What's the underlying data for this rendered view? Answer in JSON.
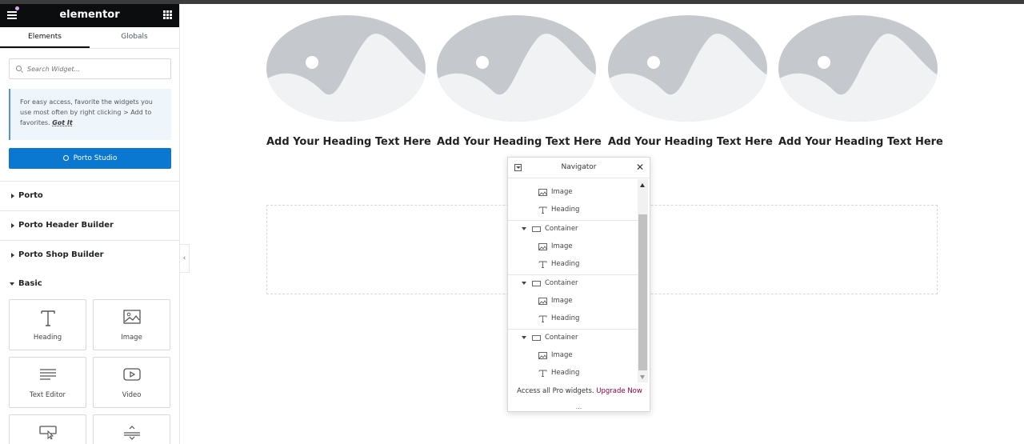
{
  "header": {
    "logo": "elementor"
  },
  "tabs": [
    {
      "label": "Elements"
    },
    {
      "label": "Globals"
    }
  ],
  "search": {
    "placeholder": "Search Widget..."
  },
  "tip": {
    "text": "For easy access, favorite the widgets you use most often by right clicking > Add to favorites.",
    "action": "Got It"
  },
  "porto_button": {
    "label": "Porto Studio"
  },
  "categories": [
    {
      "label": "Porto"
    },
    {
      "label": "Porto Header Builder"
    },
    {
      "label": "Porto Shop Builder"
    },
    {
      "label": "Basic"
    }
  ],
  "widgets": [
    {
      "label": "Heading"
    },
    {
      "label": "Image"
    },
    {
      "label": "Text Editor"
    },
    {
      "label": "Video"
    }
  ],
  "canvas": {
    "headings": [
      "Add Your Heading Text Here",
      "Add Your Heading Text Here",
      "Add Your Heading Text Here",
      "Add Your Heading Text Here"
    ]
  },
  "navigator": {
    "title": "Navigator",
    "rows": [
      {
        "label": "Image",
        "icon": "image-icon"
      },
      {
        "label": "Heading",
        "icon": "heading-icon"
      },
      {
        "label": "Container",
        "icon": "container-icon"
      },
      {
        "label": "Image",
        "icon": "image-icon"
      },
      {
        "label": "Heading",
        "icon": "heading-icon"
      },
      {
        "label": "Container",
        "icon": "container-icon"
      },
      {
        "label": "Image",
        "icon": "image-icon"
      },
      {
        "label": "Heading",
        "icon": "heading-icon"
      },
      {
        "label": "Container",
        "icon": "container-icon"
      },
      {
        "label": "Image",
        "icon": "image-icon"
      },
      {
        "label": "Heading",
        "icon": "heading-icon"
      }
    ],
    "footer_text": "Access all Pro widgets.",
    "footer_link": "Upgrade Now"
  },
  "colors": {
    "accent": "#0a78d1",
    "upgrade": "#93003f",
    "placeholder": "#c5c9ce"
  }
}
